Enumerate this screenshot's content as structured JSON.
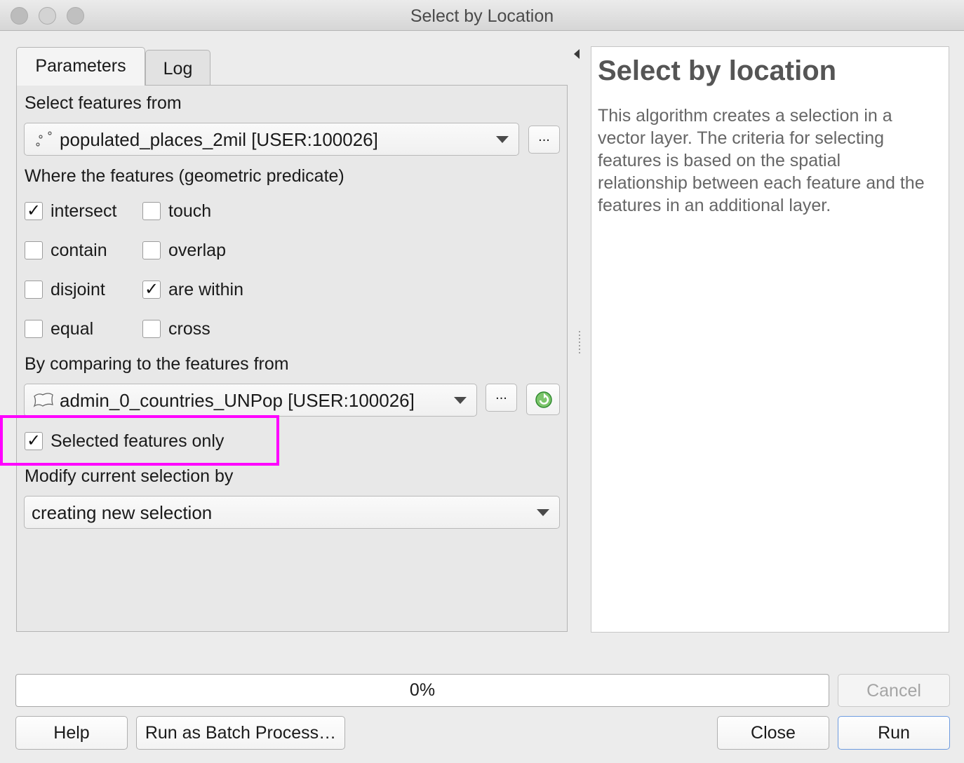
{
  "window": {
    "title": "Select by Location"
  },
  "tabs": [
    {
      "label": "Parameters"
    },
    {
      "label": "Log"
    }
  ],
  "params": {
    "input_label": "Select features from",
    "input_layer": "populated_places_2mil [USER:100026]",
    "input_layer_icon": "point-layer-icon",
    "browse_label": "...",
    "predicate_label": "Where the features (geometric predicate)",
    "predicates": [
      {
        "label": "intersect",
        "checked": true
      },
      {
        "label": "touch",
        "checked": false
      },
      {
        "label": "contain",
        "checked": false
      },
      {
        "label": "overlap",
        "checked": false
      },
      {
        "label": "disjoint",
        "checked": false
      },
      {
        "label": "are within",
        "checked": true
      },
      {
        "label": "equal",
        "checked": false
      },
      {
        "label": "cross",
        "checked": false
      }
    ],
    "compare_label": "By comparing to the features from",
    "compare_layer": "admin_0_countries_UNPop [USER:100026]",
    "compare_layer_icon": "polygon-layer-icon",
    "selected_only_label": "Selected features only",
    "selected_only_checked": true,
    "modify_label": "Modify current selection by",
    "modify_value": "creating new selection"
  },
  "help": {
    "title": "Select by location",
    "text": "This algorithm creates a selection in a vector layer. The criteria for selecting features is based on the spatial relationship between each feature and the features in an additional layer."
  },
  "progress": {
    "value": "0%",
    "fraction": 0
  },
  "buttons": {
    "cancel": "Cancel",
    "help": "Help",
    "batch": "Run as Batch Process…",
    "close": "Close",
    "run": "Run"
  },
  "colors": {
    "highlight": "#ff00ff",
    "refresh_icon": "#3aa33a"
  }
}
